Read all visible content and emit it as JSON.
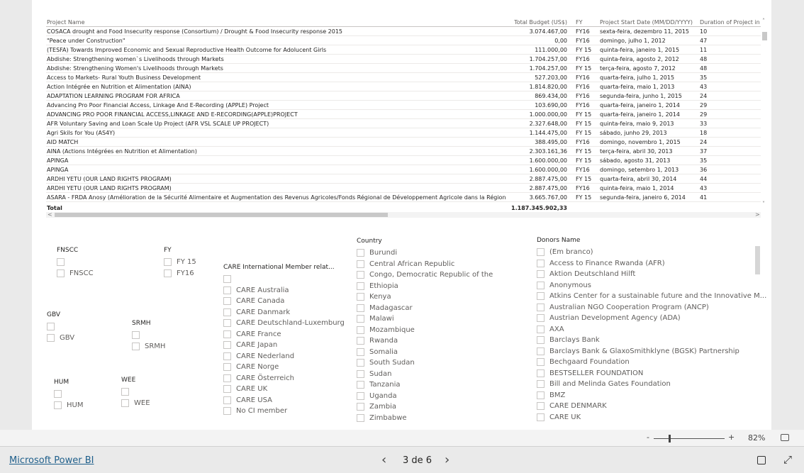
{
  "table": {
    "headers": [
      "Project Name",
      "Total Budget (US$)",
      "FY",
      "Project Start Date (MM/DD/YYYY)",
      "Duration of Project in months"
    ],
    "rows": [
      [
        " COSACA drought and Food Insecurity response (Consortium) / Drought & Food Insecurity response 2015",
        "3.074.467,00",
        "FY16",
        "sexta-feira, dezembro 11, 2015",
        "10"
      ],
      [
        "\"Peace under Construction\"",
        "0,00",
        "FY16",
        "domingo, julho 1, 2012",
        "47"
      ],
      [
        "(TESFA) Towards Improved Economic and Sexual Reproductive Health Outcome for Adolucent Girls",
        "111.000,00",
        "FY 15",
        "quinta-feira, janeiro 1, 2015",
        "11"
      ],
      [
        "Abdishe: Strengthening women`s Livelihoods through Markets",
        "1.704.257,00",
        "FY16",
        "quinta-feira, agosto 2, 2012",
        "48"
      ],
      [
        "Abdishe: Strengthening Women's Livelihoods through Markets",
        "1.704.257,00",
        "FY 15",
        "terça-feira, agosto 7, 2012",
        "48"
      ],
      [
        "Access to Markets- Rural Youth Business Development",
        "527.203,00",
        "FY16",
        "quarta-feira, julho 1, 2015",
        "35"
      ],
      [
        "Action Intégrée en Nutrition et Alimentation (AINA)",
        "1.814.820,00",
        "FY16",
        "quarta-feira, maio 1, 2013",
        "43"
      ],
      [
        "ADAPTATION LEARNING PROGRAM FOR AFRICA",
        "869.434,00",
        "FY16",
        "segunda-feira, junho 1, 2015",
        "24"
      ],
      [
        "Advancing Pro Poor Financial Access, Linkage And E-Recording (APPLE) Project",
        "103.690,00",
        "FY16",
        "quarta-feira, janeiro 1, 2014",
        "29"
      ],
      [
        "ADVANCING PRO POOR FINANCIAL ACCESS,LINKAGE AND E-RECORDING(APPLE)PROJECT",
        "1.000.000,00",
        "FY 15",
        "quarta-feira, janeiro 1, 2014",
        "29"
      ],
      [
        "AFR Voluntary Saving and Loan Scale Up Project (AFR VSL SCALE UP PROJECT)",
        "2.327.648,00",
        "FY 15",
        "quinta-feira, maio 9, 2013",
        "33"
      ],
      [
        "Agri Skils for You (AS4Y)",
        "1.144.475,00",
        "FY 15",
        "sábado, junho 29, 2013",
        "18"
      ],
      [
        "AID MATCH",
        "388.495,00",
        "FY16",
        "domingo, novembro 1, 2015",
        "24"
      ],
      [
        "AINA (Actions Intégrées en Nutrition et Alimentation)",
        "2.303.161,36",
        "FY 15",
        "terça-feira, abril 30, 2013",
        "37"
      ],
      [
        "APINGA",
        "1.600.000,00",
        "FY 15",
        "sábado, agosto 31, 2013",
        "35"
      ],
      [
        "APINGA",
        "1.600.000,00",
        "FY16",
        "domingo, setembro 1, 2013",
        "36"
      ],
      [
        "ARDHI YETU (OUR LAND RIGHTS PROGRAM)",
        "2.887.475,00",
        "FY 15",
        "quarta-feira, abril 30, 2014",
        "44"
      ],
      [
        "ARDHI YETU (OUR LAND RIGHTS PROGRAM)",
        "2.887.475,00",
        "FY16",
        "quinta-feira, maio 1, 2014",
        "43"
      ],
      [
        "ASARA - FRDA Anosy (Amélioration de la Sécurité Alimentaire et Augmentation des Revenus Agricoles/Fonds Régional de Développement Agricole dans la Région Anosy)",
        "3.665.767,00",
        "FY 15",
        "segunda-feira, janeiro 6, 2014",
        "41"
      ]
    ],
    "total_label": "Total",
    "total_value": "1.187.345.902,33"
  },
  "slicers": {
    "fnscc": {
      "title": "FNSCC",
      "items": [
        "",
        "FNSCC"
      ]
    },
    "fy": {
      "title": "FY",
      "items": [
        "FY 15",
        "FY16"
      ]
    },
    "gbv": {
      "title": "GBV",
      "items": [
        "",
        "GBV"
      ]
    },
    "srmh": {
      "title": "SRMH",
      "items": [
        "",
        "SRMH"
      ]
    },
    "hum": {
      "title": "HUM",
      "items": [
        "",
        "HUM"
      ]
    },
    "wee": {
      "title": "WEE",
      "items": [
        "",
        "WEE"
      ]
    },
    "care": {
      "title": "CARE International Member relat...",
      "items": [
        "",
        "CARE Australia",
        "CARE Canada",
        "CARE Danmark",
        "CARE Deutschland-Luxemburg",
        "CARE France",
        "CARE Japan",
        "CARE Nederland",
        "CARE Norge",
        "CARE Österreich",
        "CARE UK",
        "CARE USA",
        "No CI member"
      ]
    },
    "country": {
      "title": "Country",
      "items": [
        "Burundi",
        "Central African Republic",
        "Congo, Democratic Republic of the",
        "Ethiopia",
        "Kenya",
        "Madagascar",
        "Malawi",
        "Mozambique",
        "Rwanda",
        "Somalia",
        "South Sudan",
        "Sudan",
        "Tanzania",
        "Uganda",
        "Zambia",
        "Zimbabwe"
      ]
    },
    "donors": {
      "title": "Donors Name",
      "items": [
        "(Em branco)",
        "Access to Finance Rwanda (AFR)",
        "Aktion Deutschland Hilft",
        "Anonymous",
        "Atkins Center for a sustainable future and the Innovative M...",
        "Australian NGO Cooperation Program (ANCP)",
        "Austrian Development Agency (ADA)",
        "AXA",
        "Barclays Bank",
        "Barclays Bank & GlaxoSmithklyne (BGSK) Partnership",
        "Bechgaard Foundation",
        "BESTSELLER FOUNDATION",
        "Bill and Melinda Gates Foundation",
        "BMZ",
        "CARE DENMARK",
        "CARE UK"
      ]
    }
  },
  "zoom": {
    "minus": "-",
    "plus": "+",
    "level": "82%",
    "value_percent": 82
  },
  "footer": {
    "brand": "Microsoft Power BI",
    "page": "3 de 6",
    "prev": "‹",
    "next": "›"
  },
  "colors": {
    "brand_link": "#106ebe",
    "background": "#eaeaea"
  }
}
